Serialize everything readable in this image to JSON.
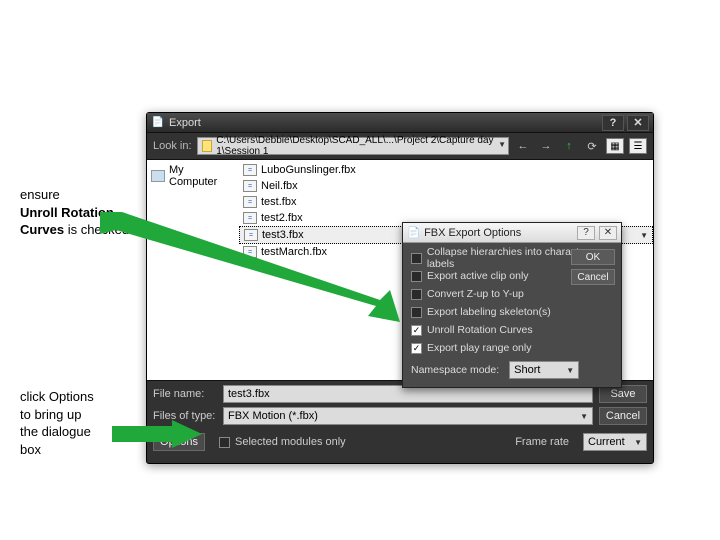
{
  "window": {
    "title": "Export"
  },
  "lookin": {
    "label": "Look in:",
    "path": "C:\\Users\\Debbie\\Desktop\\SCAD_ALL\\...\\Project 2\\Capture day 1\\Session 1"
  },
  "sidebar": {
    "my_computer": "My Computer"
  },
  "files": [
    "LuboGunslinger.fbx",
    "Neil.fbx",
    "test.fbx",
    "test2.fbx",
    "test3.fbx",
    "testMarch.fbx"
  ],
  "filename": {
    "label": "File name:",
    "value": "test3.fbx"
  },
  "filetype": {
    "label": "Files of type:",
    "value": "FBX Motion (*.fbx)"
  },
  "buttons": {
    "save": "Save",
    "cancel": "Cancel",
    "options": "Options"
  },
  "selected_only": {
    "label": "Selected modules only"
  },
  "framerate": {
    "label": "Frame rate",
    "value": "Current"
  },
  "popup": {
    "title": "FBX Export Options",
    "opts": [
      {
        "label": "Collapse hierarchies into character labels",
        "checked": false
      },
      {
        "label": "Export active clip only",
        "checked": false
      },
      {
        "label": "Convert Z-up to Y-up",
        "checked": false
      },
      {
        "label": "Export labeling skeleton(s)",
        "checked": false
      },
      {
        "label": "Unroll Rotation Curves",
        "checked": true
      },
      {
        "label": "Export play range only",
        "checked": true
      }
    ],
    "ns_label": "Namespace mode:",
    "ns_value": "Short",
    "ok": "OK",
    "cancel": "Cancel"
  },
  "annotations": {
    "a1_l1": "ensure",
    "a1_bold": "Unroll Rotation Curves",
    "a1_l3": " is checked",
    "a2_l1": "click Options",
    "a2_l2": "to bring up",
    "a2_l3": "the dialogue",
    "a2_l4": "box"
  }
}
